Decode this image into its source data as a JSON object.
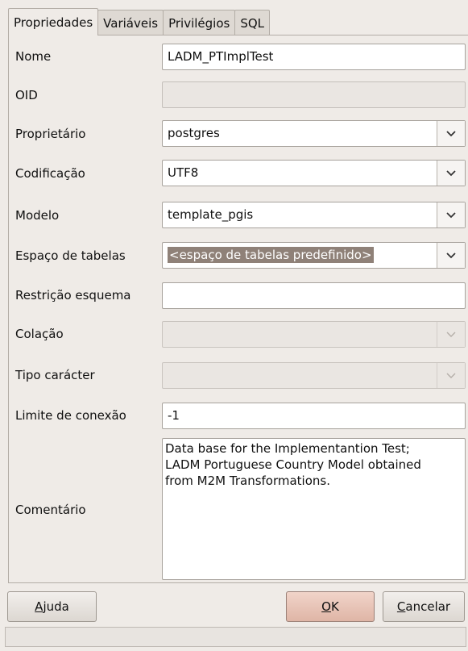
{
  "tabs": [
    "Propriedades",
    "Variáveis",
    "Privilégios",
    "SQL"
  ],
  "fields": {
    "nome": {
      "label": "Nome",
      "value": "LADM_PTImplTest"
    },
    "oid": {
      "label": "OID",
      "value": ""
    },
    "proprietario": {
      "label": "Proprietário",
      "value": "postgres"
    },
    "codificacao": {
      "label": "Codificação",
      "value": "UTF8"
    },
    "modelo": {
      "label": "Modelo",
      "value": "template_pgis"
    },
    "espaco": {
      "label": "Espaço de tabelas",
      "value": "<espaço de tabelas predefinido>"
    },
    "restricao": {
      "label": "Restrição esquema",
      "value": ""
    },
    "colacao": {
      "label": "Colação",
      "value": ""
    },
    "tipo": {
      "label": "Tipo carácter",
      "value": ""
    },
    "limite": {
      "label": "Limite de conexão",
      "value": "-1"
    },
    "comentario": {
      "label": "Comentário",
      "value": "Data base for the Implementantion Test;\nLADM Portuguese Country Model obtained\nfrom M2M Transformations."
    }
  },
  "buttons": {
    "ajuda": {
      "mnemonic": "A",
      "rest": "juda"
    },
    "ok": {
      "mnemonic": "O",
      "rest": "K"
    },
    "cancelar": {
      "mnemonic": "C",
      "rest": "ancelar"
    }
  },
  "icons": {
    "dropdown": "chevron-down-icon"
  }
}
